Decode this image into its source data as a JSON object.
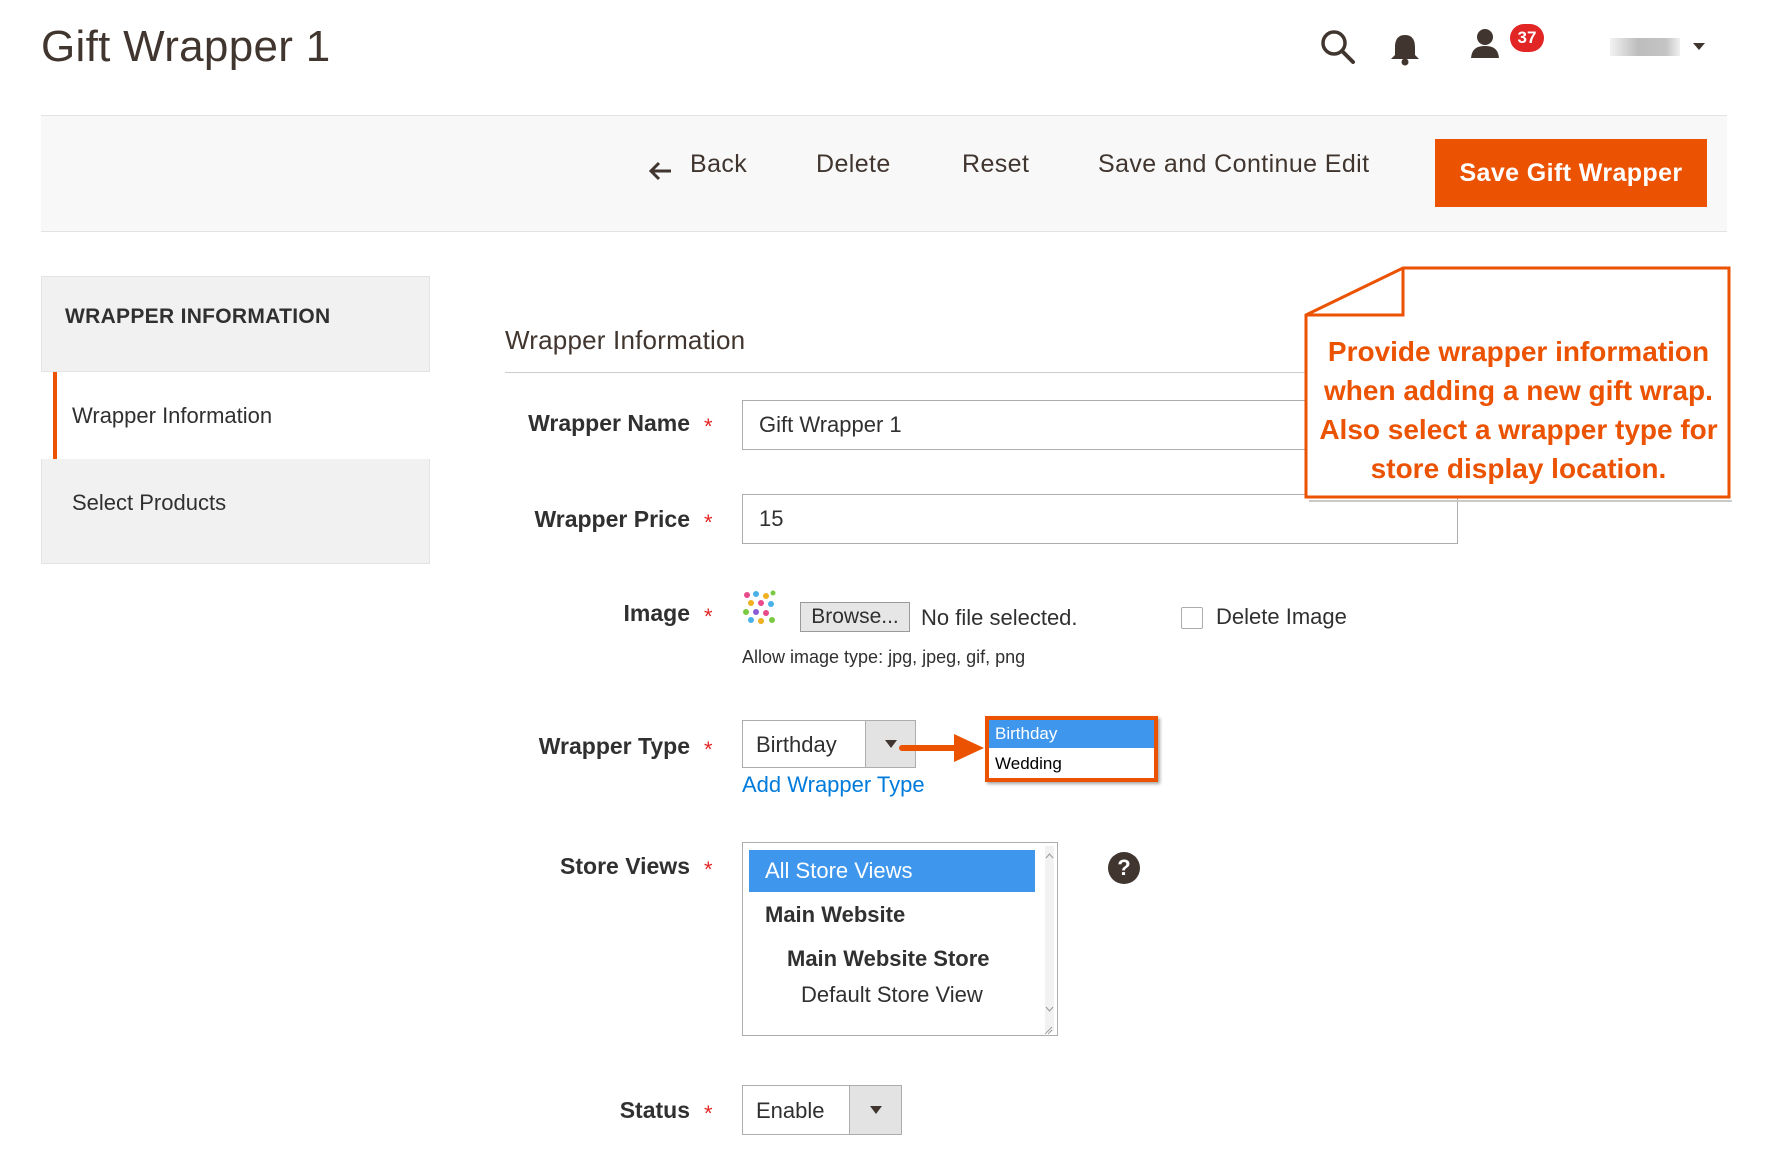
{
  "header": {
    "title": "Gift Wrapper 1",
    "notifications_count": "37",
    "icons": [
      "search-icon",
      "bell-icon",
      "user-icon",
      "chevron-down-icon"
    ]
  },
  "actions": {
    "back": "Back",
    "delete": "Delete",
    "reset": "Reset",
    "save_continue": "Save and Continue Edit",
    "save": "Save Gift Wrapper"
  },
  "sidebar": {
    "heading": "WRAPPER INFORMATION",
    "items": [
      {
        "label": "Wrapper Information",
        "active": true
      },
      {
        "label": "Select Products",
        "active": false
      }
    ]
  },
  "form": {
    "section_title": "Wrapper Information",
    "wrapper_name": {
      "label": "Wrapper Name",
      "value": "Gift Wrapper 1"
    },
    "wrapper_price": {
      "label": "Wrapper Price",
      "value": "15"
    },
    "image": {
      "label": "Image",
      "browse": "Browse...",
      "file_status": "No file selected.",
      "delete_label": "Delete Image",
      "delete_checked": false,
      "note": "Allow image type: jpg, jpeg, gif, png"
    },
    "wrapper_type": {
      "label": "Wrapper Type",
      "selected": "Birthday",
      "options": [
        "Birthday",
        "Wedding"
      ],
      "add_link": "Add Wrapper Type"
    },
    "store_views": {
      "label": "Store Views",
      "options": [
        {
          "label": "All Store Views",
          "selected": true
        },
        {
          "label": "Main Website",
          "selected": false
        },
        {
          "label": "Main Website Store",
          "selected": false
        },
        {
          "label": "Default Store View",
          "selected": false
        }
      ]
    },
    "status": {
      "label": "Status",
      "value": "Enable"
    },
    "required_mark": "*",
    "help_glyph": "?"
  },
  "callout": {
    "line1": "Provide wrapper information",
    "line2": "when adding a new gift wrap.",
    "line3": "Also select a wrapper type for",
    "line4": "store display location."
  },
  "colors": {
    "accent": "#eb5202",
    "link": "#007bdb",
    "required": "#e22626",
    "selection": "#3f97ed"
  }
}
